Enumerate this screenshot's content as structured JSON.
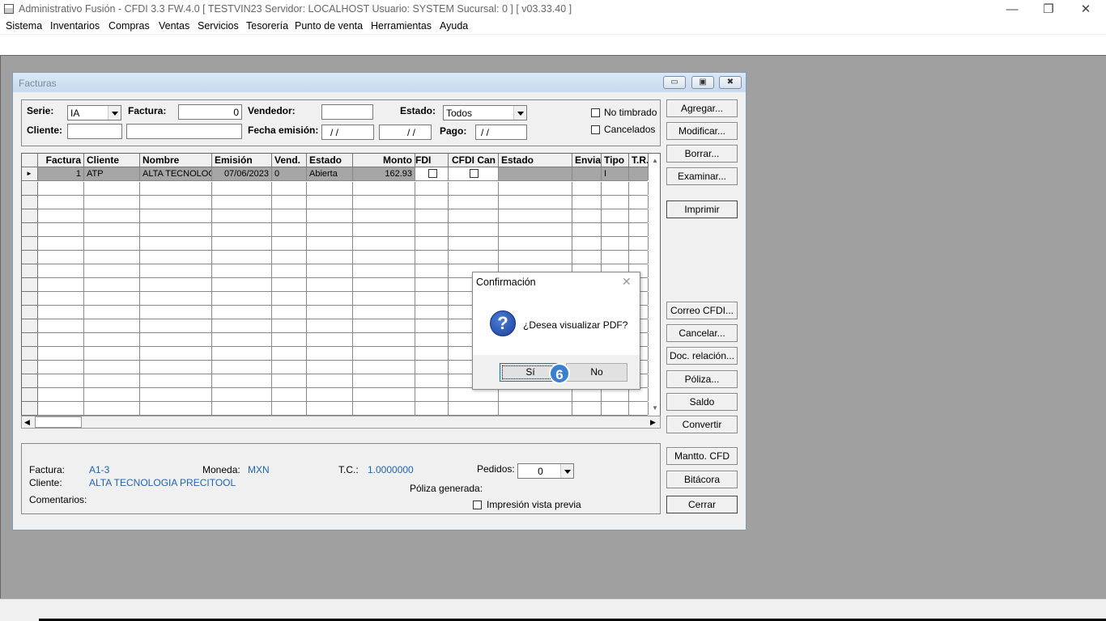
{
  "titlebar": {
    "title": "Administrativo Fusión - CFDI 3.3 FW.4.0 [ TESTVIN23   Servidor: LOCALHOST   Usuario: SYSTEM     Sucursal: 0 ] [ v03.33.40 ]",
    "minimize": "—",
    "maximize": "❐",
    "close": "✕"
  },
  "menu": [
    "Sistema",
    "Inventarios",
    "Compras",
    "Ventas",
    "Servicios",
    "Tesorería",
    "Punto de venta",
    "Herramientas",
    "Ayuda"
  ],
  "child": {
    "title": "Facturas",
    "filter": {
      "serie_label": "Serie:",
      "serie_value": "IA",
      "factura_label": "Factura:",
      "factura_value": "0",
      "vendedor_label": "Vendedor:",
      "vendedor_value": "",
      "estado_label": "Estado:",
      "estado_value": "Todos",
      "cliente_label": "Cliente:",
      "cliente_code": "",
      "cliente_name": "",
      "fecha_label": "Fecha emisión:",
      "fecha_from": "/ /",
      "fecha_to": "/ /",
      "pago_label": "Pago:",
      "pago_value": "/ /",
      "no_timbrado": "No timbrado",
      "cancelados": "Cancelados"
    },
    "grid": {
      "headers": [
        "Factura",
        "Cliente",
        "Nombre",
        "Emisión",
        "Vend.",
        "Estado",
        "Monto",
        "FDI",
        "CFDI Can",
        "Estado",
        "Envia",
        "Tipo",
        "T.R."
      ],
      "row": {
        "factura": "1",
        "cliente": "ATP",
        "nombre": "ALTA TECNOLOG",
        "emision": "07/06/2023",
        "vend": "0",
        "estado": "Abierta",
        "monto": "162.93",
        "tipo": "I"
      }
    },
    "info": {
      "factura_label": "Factura:",
      "factura_value": "A1-3",
      "moneda_label": "Moneda:",
      "moneda_value": "MXN",
      "tc_label": "T.C.:",
      "tc_value": "1.0000000",
      "pedidos_label": "Pedidos:",
      "pedidos_value": "0",
      "cliente_label": "Cliente:",
      "cliente_value": "ALTA TECNOLOGIA PRECITOOL",
      "poliza_label": "Póliza generada:",
      "comentarios_label": "Comentarios:",
      "impresion_label": "Impresión vista previa"
    },
    "buttons": {
      "agregar": "Agregar...",
      "modificar": "Modificar...",
      "borrar": "Borrar...",
      "examinar": "Examinar...",
      "imprimir": "Imprimir",
      "correo": "Correo CFDI...",
      "cancelar": "Cancelar...",
      "doc_relacion": "Doc. relación...",
      "poliza": "Póliza...",
      "saldo": "Saldo",
      "convertir": "Convertir",
      "mantto": "Mantto. CFD",
      "bitacora": "Bitácora",
      "cerrar": "Cerrar"
    }
  },
  "dialog": {
    "title": "Confirmación",
    "message": "¿Desea visualizar PDF?",
    "yes": "Sí",
    "no": "No",
    "icon": "question-icon"
  },
  "badge": "6"
}
